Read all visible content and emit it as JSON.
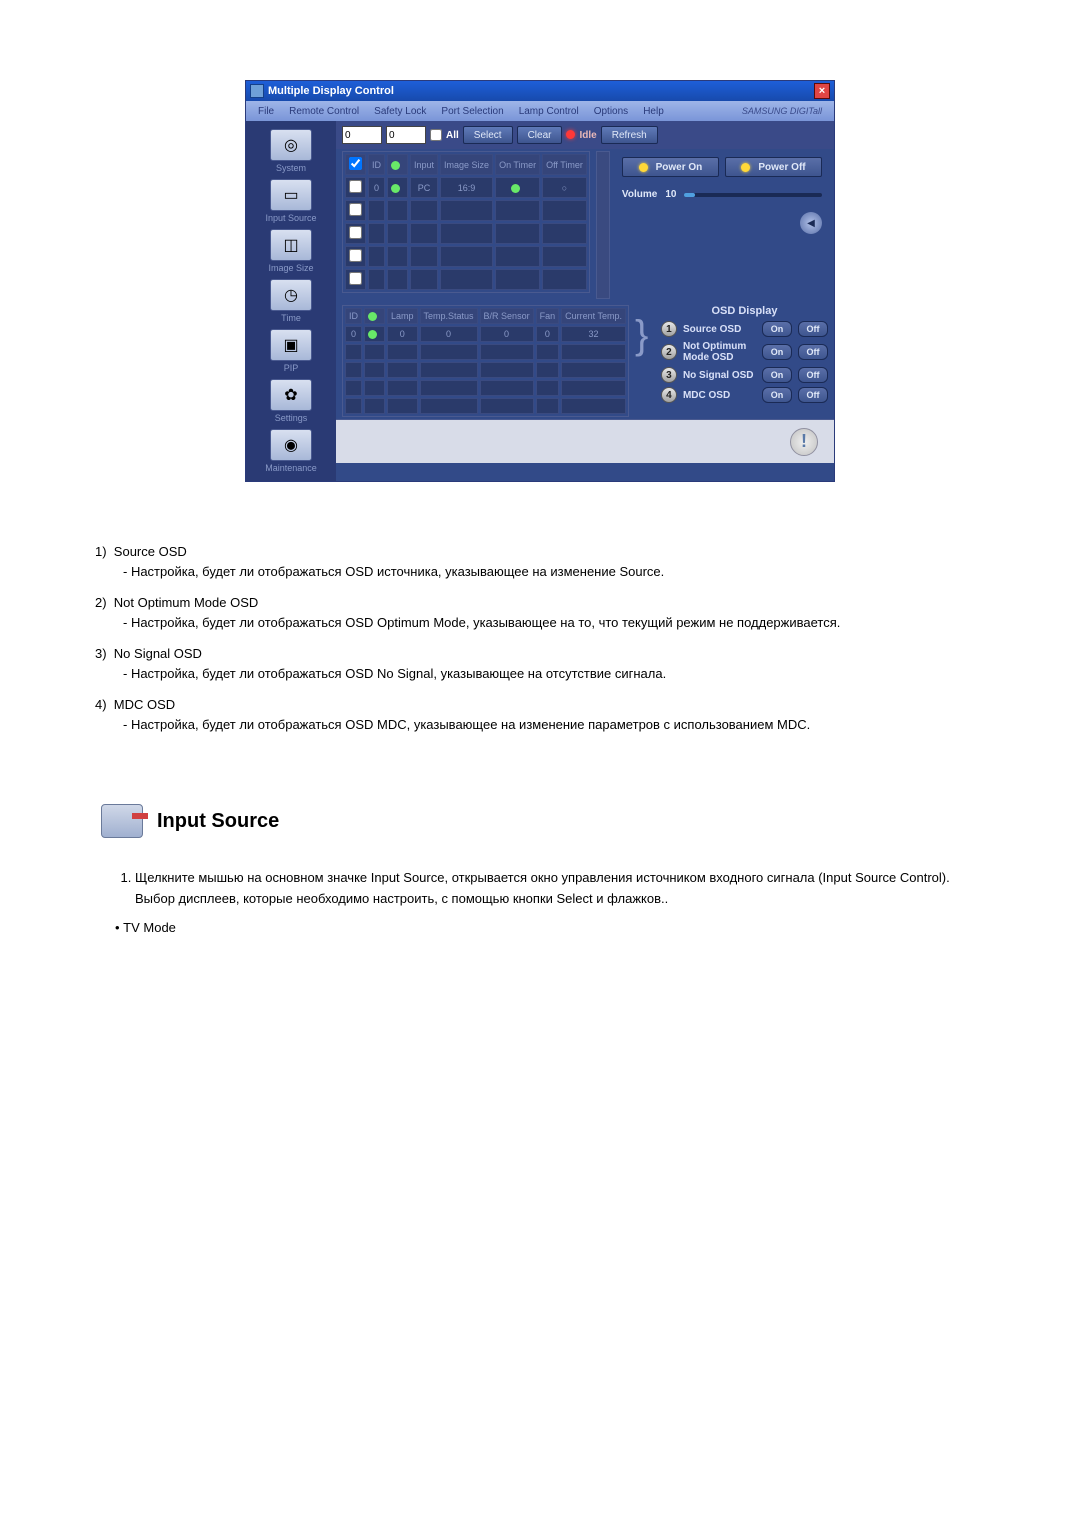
{
  "window": {
    "title": "Multiple Display Control",
    "brand": "SAMSUNG DIGITall"
  },
  "menu": {
    "file": "File",
    "remote": "Remote Control",
    "safety": "Safety Lock",
    "port": "Port Selection",
    "lamp": "Lamp Control",
    "options": "Options",
    "help": "Help"
  },
  "sidebar": {
    "system": "System",
    "input": "Input Source",
    "image": "Image Size",
    "time": "Time",
    "pip": "PIP",
    "settings": "Settings",
    "maint": "Maintenance"
  },
  "toolbar": {
    "dd1": "0",
    "dd2": "0",
    "all": "All",
    "select": "Select",
    "clear": "Clear",
    "idle": "Idle",
    "refresh": "Refresh"
  },
  "power": {
    "on": "Power On",
    "off": "Power Off",
    "volume": "Volume",
    "volval": "10"
  },
  "table1": {
    "headers": [
      "",
      "ID",
      "",
      "Input",
      "Image Size",
      "On Timer",
      "Off Timer"
    ],
    "row": [
      "",
      "0",
      "",
      "PC",
      "16:9",
      "",
      ""
    ]
  },
  "table2": {
    "headers": [
      "ID",
      "",
      "Lamp",
      "Temp.Status",
      "B/R Sensor",
      "Fan",
      "Current Temp."
    ],
    "row": [
      "0",
      "",
      "0",
      "0",
      "0",
      "0",
      "32"
    ]
  },
  "osd": {
    "title": "OSD Display",
    "items": [
      {
        "n": "1",
        "label": "Source OSD"
      },
      {
        "n": "2",
        "label": "Not Optimum Mode OSD"
      },
      {
        "n": "3",
        "label": "No Signal OSD"
      },
      {
        "n": "4",
        "label": "MDC OSD"
      }
    ],
    "on": "On",
    "off": "Off"
  },
  "desc": [
    {
      "num": "1)",
      "title": "Source OSD",
      "body": "- Настройка, будет ли отображаться OSD источника, указывающее на изменение Source."
    },
    {
      "num": "2)",
      "title": "Not Optimum Mode OSD",
      "body": "- Настройка, будет ли отображаться OSD Optimum Mode, указывающее на то, что текущий режим не поддерживается."
    },
    {
      "num": "3)",
      "title": "No Signal OSD",
      "body": "- Настройка, будет ли отображаться OSD No Signal, указывающее на отсутствие сигнала."
    },
    {
      "num": "4)",
      "title": "MDC OSD",
      "body": "- Настройка, будет ли отображаться OSD MDC, указывающее на изменение параметров с использованием MDC."
    }
  ],
  "section": {
    "heading": "Input Source"
  },
  "notes": {
    "n1": "Щелкните мышью на основном значке Input Source, открывается окно управления источником входного сигнала (Input Source Control).",
    "n1b": "Выбор дисплеев, которые необходимо настроить, с помощью кнопки Select и флажков..",
    "bul": "TV Mode"
  }
}
